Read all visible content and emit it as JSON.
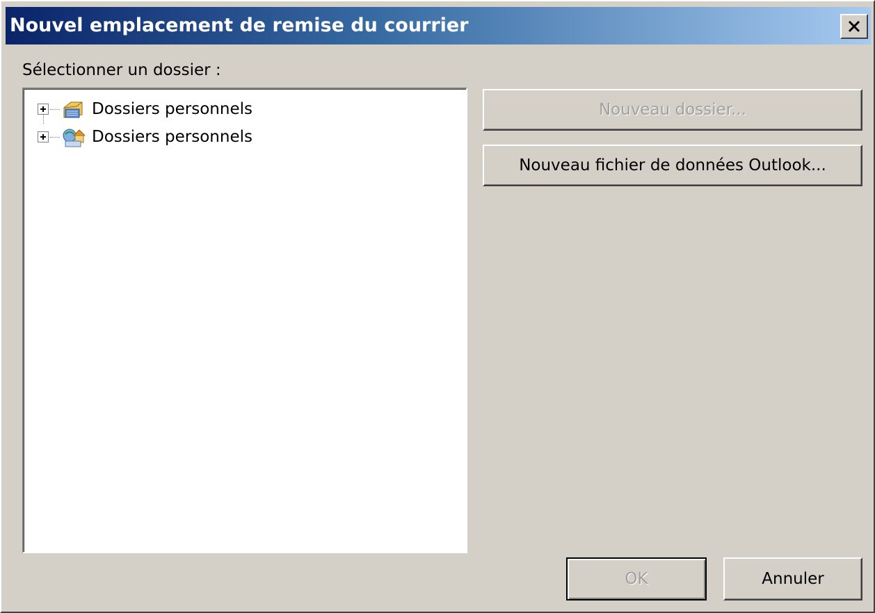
{
  "window": {
    "title": "Nouvel emplacement de remise du courrier",
    "close_label": "✕"
  },
  "folder_select": {
    "label": "Sélectionner un dossier :"
  },
  "tree": {
    "items": [
      {
        "label": "Dossiers personnels",
        "icon": "pst-folder-icon"
      },
      {
        "label": "Dossiers personnels",
        "icon": "home-mailbox-icon"
      }
    ]
  },
  "buttons": {
    "new_folder": "Nouveau dossier...",
    "new_data_file": "Nouveau fichier de données Outlook...",
    "ok": "OK",
    "cancel": "Annuler"
  },
  "colors": {
    "titlebar_start": "#0a246a",
    "titlebar_end": "#a6caf0",
    "face": "#d4d0c8"
  }
}
